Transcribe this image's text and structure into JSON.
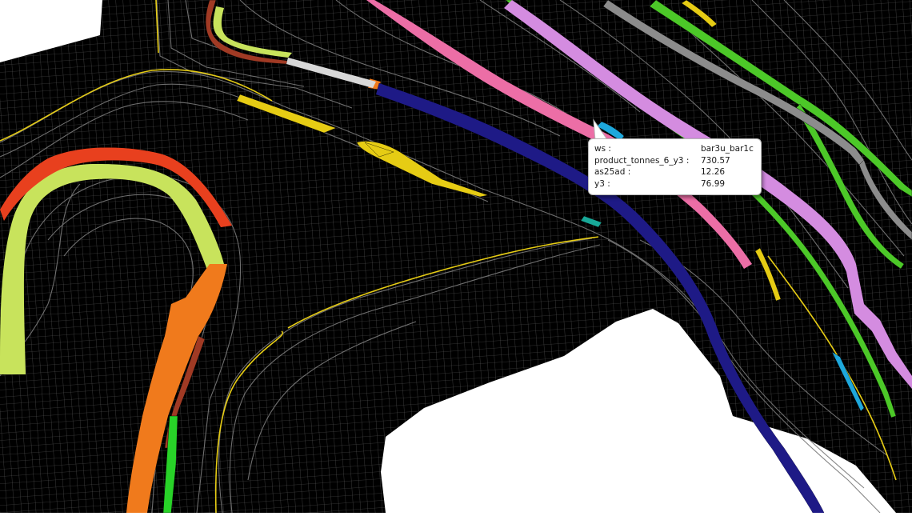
{
  "viewport": {
    "background": "#000000",
    "void_color": "#ffffff",
    "grid_line_color": "#6e6e6e",
    "contour_line_color": "#7a7a7a"
  },
  "tooltip": {
    "rows": [
      {
        "key": "ws :",
        "value": "bar3u_bar1c"
      },
      {
        "key": "product_tonnes_6_y3 :",
        "value": "730.57"
      },
      {
        "key": "as25ad :",
        "value": "12.26"
      },
      {
        "key": "y3 :",
        "value": "76.99"
      }
    ]
  },
  "block_colors": {
    "lime": "#c8e35c",
    "red": "#e8401e",
    "orange": "#f07a1c",
    "brown": "#a03a24",
    "green": "#28d228",
    "yellow": "#e6cc14",
    "navy": "#1e1a86",
    "pink": "#ec6ea6",
    "violet": "#d48ce0",
    "cyan": "#1ea8dc",
    "teal": "#18a898",
    "bright_green": "#4cc828",
    "grey": "#8c8c8c"
  }
}
